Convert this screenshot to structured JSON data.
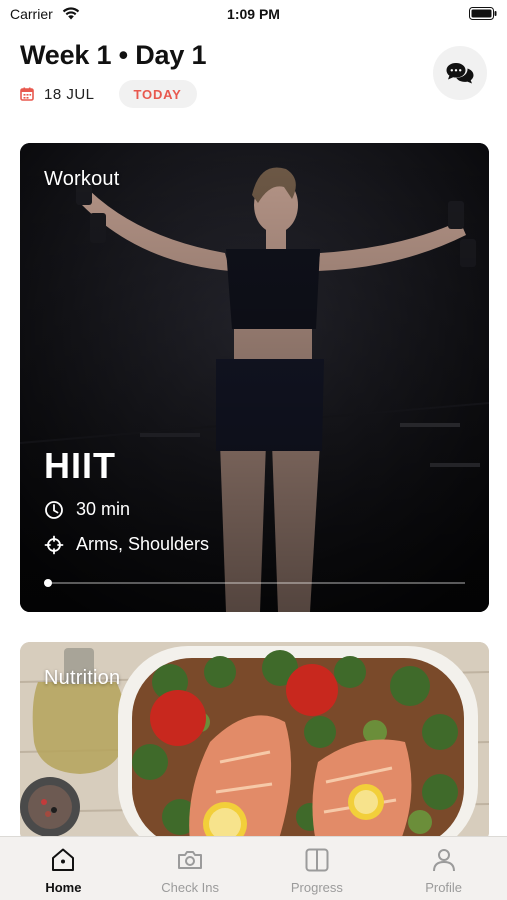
{
  "status_bar": {
    "carrier": "Carrier",
    "time": "1:09 PM"
  },
  "header": {
    "title": "Week 1 • Day 1",
    "date": "18 JUL",
    "today_label": "TODAY",
    "accent_color": "#e8584e"
  },
  "workout_card": {
    "section_label": "Workout",
    "name": "HIIT",
    "duration": "30 min",
    "focus": "Arms, Shoulders",
    "progress": 0.0
  },
  "nutrition_card": {
    "section_label": "Nutrition"
  },
  "tab_bar": {
    "active": "Home",
    "tabs": [
      {
        "label": "Home",
        "icon": "home-icon"
      },
      {
        "label": "Check Ins",
        "icon": "camera-icon"
      },
      {
        "label": "Progress",
        "icon": "split-square-icon"
      },
      {
        "label": "Profile",
        "icon": "person-icon"
      }
    ]
  }
}
